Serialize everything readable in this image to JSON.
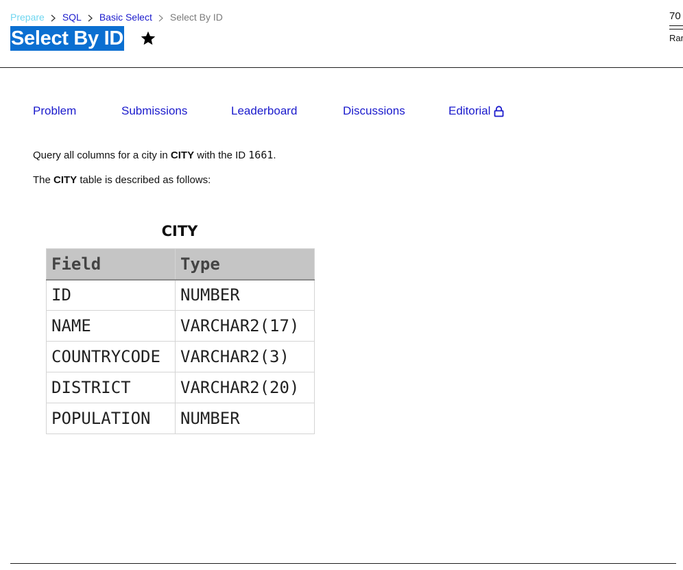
{
  "breadcrumb": {
    "items": [
      "Prepare",
      "SQL",
      "Basic Select",
      "Select By ID"
    ]
  },
  "header": {
    "title": "Select By ID",
    "points": "70",
    "rank_label": "Rar"
  },
  "tabs": [
    {
      "label": "Problem"
    },
    {
      "label": "Submissions"
    },
    {
      "label": "Leaderboard"
    },
    {
      "label": "Discussions"
    },
    {
      "label": "Editorial"
    }
  ],
  "problem": {
    "line1_prefix": "Query all columns for a city in ",
    "line1_table": "CITY",
    "line1_mid": " with the ID ",
    "line1_id": "1661",
    "line1_suffix": ".",
    "line2_prefix": "The ",
    "line2_table": "CITY",
    "line2_suffix": " table is described as follows:"
  },
  "schema_table": {
    "caption": "CITY",
    "headers": [
      "Field",
      "Type"
    ],
    "rows": [
      [
        "ID",
        "NUMBER"
      ],
      [
        "NAME",
        "VARCHAR2(17)"
      ],
      [
        "COUNTRYCODE",
        "VARCHAR2(3)"
      ],
      [
        "DISTRICT",
        "VARCHAR2(20)"
      ],
      [
        "POPULATION",
        "NUMBER"
      ]
    ]
  },
  "colors": {
    "link": "#1a1acc",
    "title_highlight": "#0b6fd1",
    "faded_crumb": "#6fd6f0",
    "table_header_bg": "#c5c5c5"
  },
  "icons": {
    "breadcrumb_separator": "chevron-right-icon",
    "favorite": "star-icon",
    "editorial_lock": "lock-icon"
  }
}
